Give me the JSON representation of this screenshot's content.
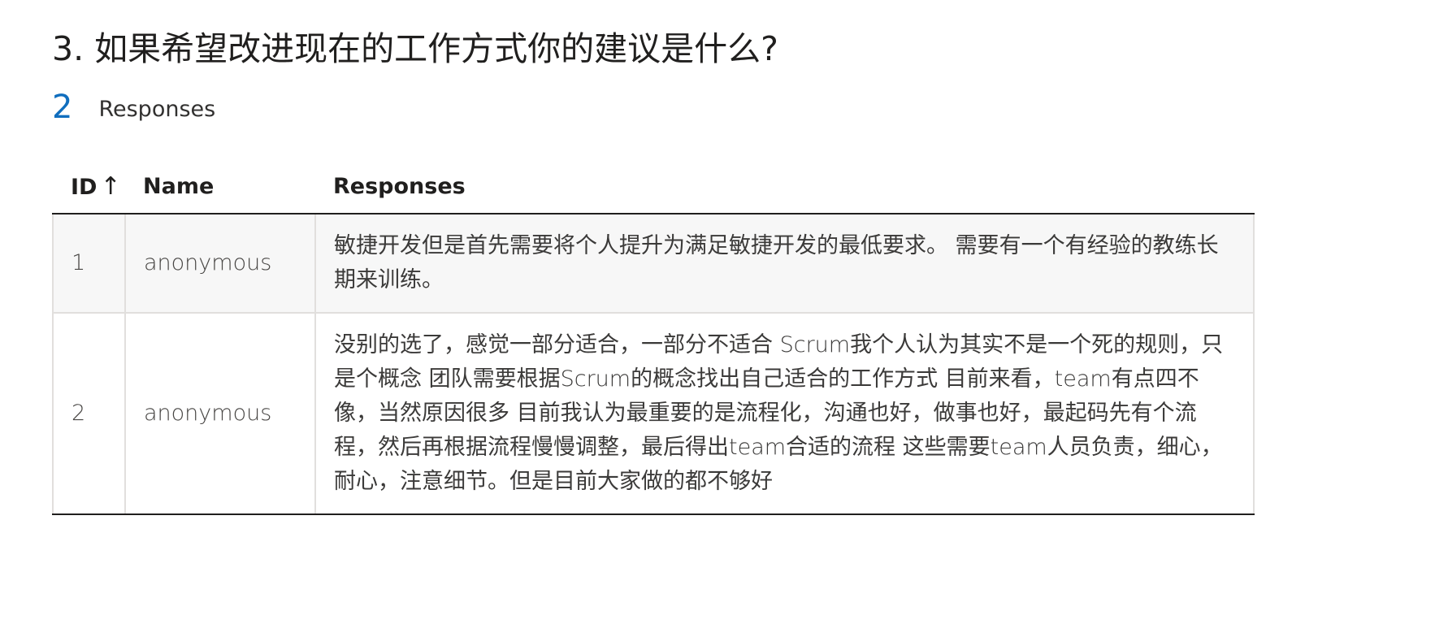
{
  "question": {
    "title": "3. 如果希望改进现在的工作方式你的建议是什么?"
  },
  "summary": {
    "count": "2",
    "label": "Responses"
  },
  "table": {
    "headers": {
      "id": "ID",
      "id_sort_indicator": "↑",
      "name": "Name",
      "responses": "Responses"
    },
    "rows": [
      {
        "id": "1",
        "name": "anonymous",
        "response": "敏捷开发但是首先需要将个人提升为满足敏捷开发的最低要求。 需要有一个有经验的教练长期来训练。"
      },
      {
        "id": "2",
        "name": "anonymous",
        "response": "没别的选了，感觉一部分适合，一部分不适合 Scrum我个人认为其实不是一个死的规则，只是个概念 团队需要根据Scrum的概念找出自己适合的工作方式 目前来看，team有点四不像，当然原因很多 目前我认为最重要的是流程化，沟通也好，做事也好，最起码先有个流程，然后再根据流程慢慢调整，最后得出team合适的流程 这些需要team人员负责，细心，耐心，注意细节。但是目前大家做的都不够好"
      }
    ]
  },
  "colors": {
    "accent": "#106ebe",
    "text": "#323130",
    "row_alt_bg": "#f7f7f7",
    "border": "#e1dfdd",
    "header_rule": "#201f1e"
  }
}
